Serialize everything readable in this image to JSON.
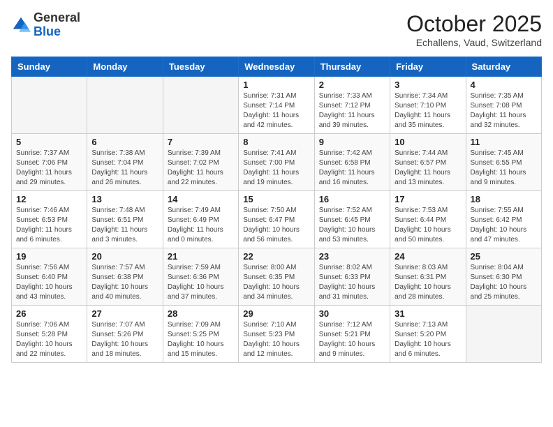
{
  "header": {
    "logo_general": "General",
    "logo_blue": "Blue",
    "month": "October 2025",
    "location": "Echallens, Vaud, Switzerland"
  },
  "days_of_week": [
    "Sunday",
    "Monday",
    "Tuesday",
    "Wednesday",
    "Thursday",
    "Friday",
    "Saturday"
  ],
  "weeks": [
    [
      {
        "num": "",
        "info": ""
      },
      {
        "num": "",
        "info": ""
      },
      {
        "num": "",
        "info": ""
      },
      {
        "num": "1",
        "info": "Sunrise: 7:31 AM\nSunset: 7:14 PM\nDaylight: 11 hours\nand 42 minutes."
      },
      {
        "num": "2",
        "info": "Sunrise: 7:33 AM\nSunset: 7:12 PM\nDaylight: 11 hours\nand 39 minutes."
      },
      {
        "num": "3",
        "info": "Sunrise: 7:34 AM\nSunset: 7:10 PM\nDaylight: 11 hours\nand 35 minutes."
      },
      {
        "num": "4",
        "info": "Sunrise: 7:35 AM\nSunset: 7:08 PM\nDaylight: 11 hours\nand 32 minutes."
      }
    ],
    [
      {
        "num": "5",
        "info": "Sunrise: 7:37 AM\nSunset: 7:06 PM\nDaylight: 11 hours\nand 29 minutes."
      },
      {
        "num": "6",
        "info": "Sunrise: 7:38 AM\nSunset: 7:04 PM\nDaylight: 11 hours\nand 26 minutes."
      },
      {
        "num": "7",
        "info": "Sunrise: 7:39 AM\nSunset: 7:02 PM\nDaylight: 11 hours\nand 22 minutes."
      },
      {
        "num": "8",
        "info": "Sunrise: 7:41 AM\nSunset: 7:00 PM\nDaylight: 11 hours\nand 19 minutes."
      },
      {
        "num": "9",
        "info": "Sunrise: 7:42 AM\nSunset: 6:58 PM\nDaylight: 11 hours\nand 16 minutes."
      },
      {
        "num": "10",
        "info": "Sunrise: 7:44 AM\nSunset: 6:57 PM\nDaylight: 11 hours\nand 13 minutes."
      },
      {
        "num": "11",
        "info": "Sunrise: 7:45 AM\nSunset: 6:55 PM\nDaylight: 11 hours\nand 9 minutes."
      }
    ],
    [
      {
        "num": "12",
        "info": "Sunrise: 7:46 AM\nSunset: 6:53 PM\nDaylight: 11 hours\nand 6 minutes."
      },
      {
        "num": "13",
        "info": "Sunrise: 7:48 AM\nSunset: 6:51 PM\nDaylight: 11 hours\nand 3 minutes."
      },
      {
        "num": "14",
        "info": "Sunrise: 7:49 AM\nSunset: 6:49 PM\nDaylight: 11 hours\nand 0 minutes."
      },
      {
        "num": "15",
        "info": "Sunrise: 7:50 AM\nSunset: 6:47 PM\nDaylight: 10 hours\nand 56 minutes."
      },
      {
        "num": "16",
        "info": "Sunrise: 7:52 AM\nSunset: 6:45 PM\nDaylight: 10 hours\nand 53 minutes."
      },
      {
        "num": "17",
        "info": "Sunrise: 7:53 AM\nSunset: 6:44 PM\nDaylight: 10 hours\nand 50 minutes."
      },
      {
        "num": "18",
        "info": "Sunrise: 7:55 AM\nSunset: 6:42 PM\nDaylight: 10 hours\nand 47 minutes."
      }
    ],
    [
      {
        "num": "19",
        "info": "Sunrise: 7:56 AM\nSunset: 6:40 PM\nDaylight: 10 hours\nand 43 minutes."
      },
      {
        "num": "20",
        "info": "Sunrise: 7:57 AM\nSunset: 6:38 PM\nDaylight: 10 hours\nand 40 minutes."
      },
      {
        "num": "21",
        "info": "Sunrise: 7:59 AM\nSunset: 6:36 PM\nDaylight: 10 hours\nand 37 minutes."
      },
      {
        "num": "22",
        "info": "Sunrise: 8:00 AM\nSunset: 6:35 PM\nDaylight: 10 hours\nand 34 minutes."
      },
      {
        "num": "23",
        "info": "Sunrise: 8:02 AM\nSunset: 6:33 PM\nDaylight: 10 hours\nand 31 minutes."
      },
      {
        "num": "24",
        "info": "Sunrise: 8:03 AM\nSunset: 6:31 PM\nDaylight: 10 hours\nand 28 minutes."
      },
      {
        "num": "25",
        "info": "Sunrise: 8:04 AM\nSunset: 6:30 PM\nDaylight: 10 hours\nand 25 minutes."
      }
    ],
    [
      {
        "num": "26",
        "info": "Sunrise: 7:06 AM\nSunset: 5:28 PM\nDaylight: 10 hours\nand 22 minutes."
      },
      {
        "num": "27",
        "info": "Sunrise: 7:07 AM\nSunset: 5:26 PM\nDaylight: 10 hours\nand 18 minutes."
      },
      {
        "num": "28",
        "info": "Sunrise: 7:09 AM\nSunset: 5:25 PM\nDaylight: 10 hours\nand 15 minutes."
      },
      {
        "num": "29",
        "info": "Sunrise: 7:10 AM\nSunset: 5:23 PM\nDaylight: 10 hours\nand 12 minutes."
      },
      {
        "num": "30",
        "info": "Sunrise: 7:12 AM\nSunset: 5:21 PM\nDaylight: 10 hours\nand 9 minutes."
      },
      {
        "num": "31",
        "info": "Sunrise: 7:13 AM\nSunset: 5:20 PM\nDaylight: 10 hours\nand 6 minutes."
      },
      {
        "num": "",
        "info": ""
      }
    ]
  ]
}
